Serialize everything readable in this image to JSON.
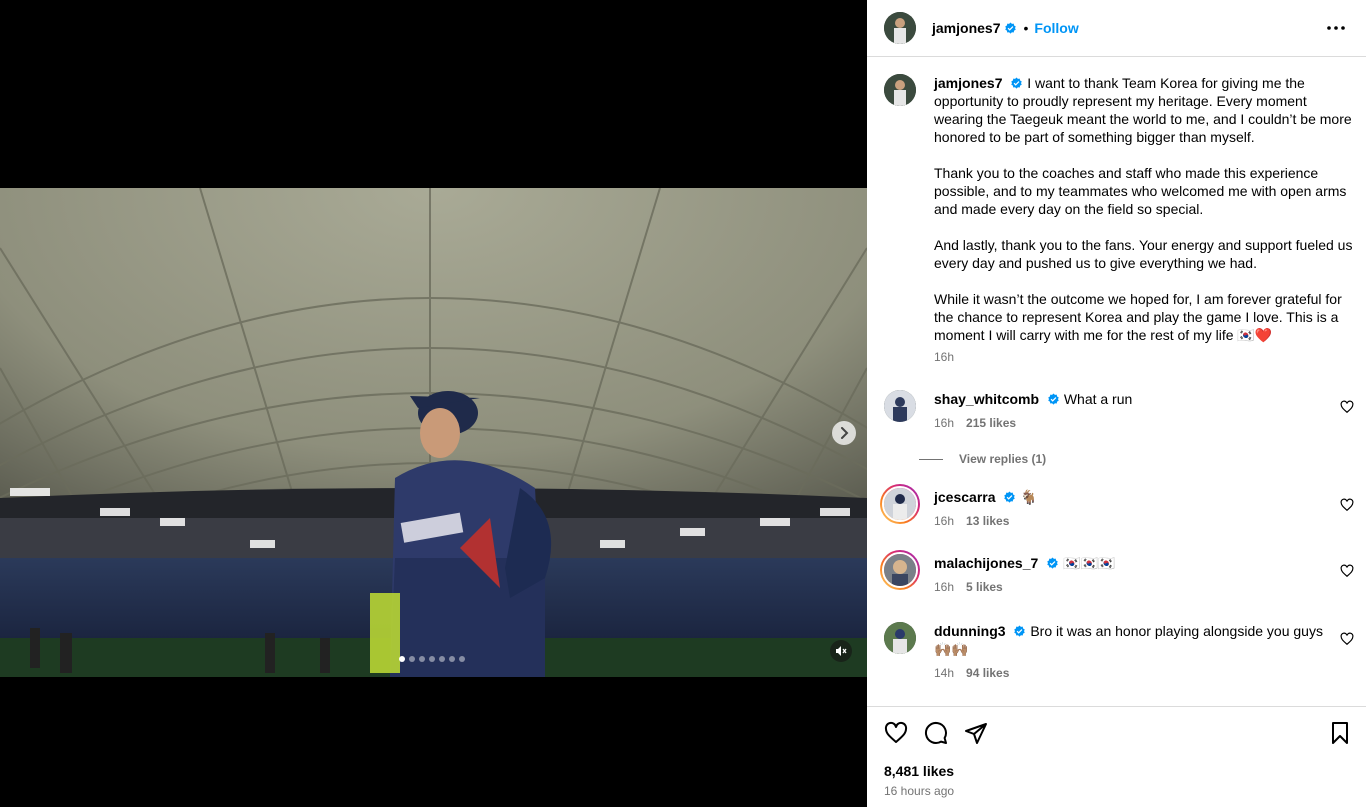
{
  "post": {
    "username": "jamjones7",
    "follow_label": "Follow",
    "bullet": "•",
    "more_icon": "more-horizontal-icon"
  },
  "media": {
    "carousel_count": 7,
    "active_index": 0
  },
  "caption": {
    "username": "jamjones7",
    "paragraphs": [
      "I want to thank Team Korea for giving me the opportunity to proudly represent my heritage. Every moment wearing the Taegeuk meant the world to me, and I couldn’t be more honored to be part of something bigger than myself.",
      "Thank you to the coaches and staff who made this experience possible, and to my teammates who welcomed me with open arms and made every day on the field so special.",
      "And lastly, thank you to the fans. Your energy and support fueled us every day and pushed us to give everything we had.",
      "While it wasn’t the outcome we hoped for, I am forever grateful for the chance to represent Korea and play the game I love. This is a moment I will carry with me for the rest of my life 🇰🇷❤️"
    ],
    "time": "16h"
  },
  "comments": [
    {
      "username": "shay_whitcomb",
      "text": "What a run",
      "time": "16h",
      "likes": "215 likes",
      "replies": "View replies (1)"
    },
    {
      "username": "jcescarra",
      "text": "🐐",
      "time": "16h",
      "likes": "13 likes"
    },
    {
      "username": "malachijones_7",
      "text": "🇰🇷🇰🇷🇰🇷",
      "time": "16h",
      "likes": "5 likes"
    },
    {
      "username": "ddunning3",
      "text": "Bro it was an honor playing alongside you guys 🙌🏽🙌🏽",
      "time": "14h",
      "likes": "94 likes"
    }
  ],
  "footer": {
    "likes": "8,481 likes",
    "posted": "16 hours ago"
  },
  "colors": {
    "accent": "#0095f6",
    "verified": "#0095f6",
    "secondary_text": "#737373",
    "border": "#dbdbdb"
  }
}
